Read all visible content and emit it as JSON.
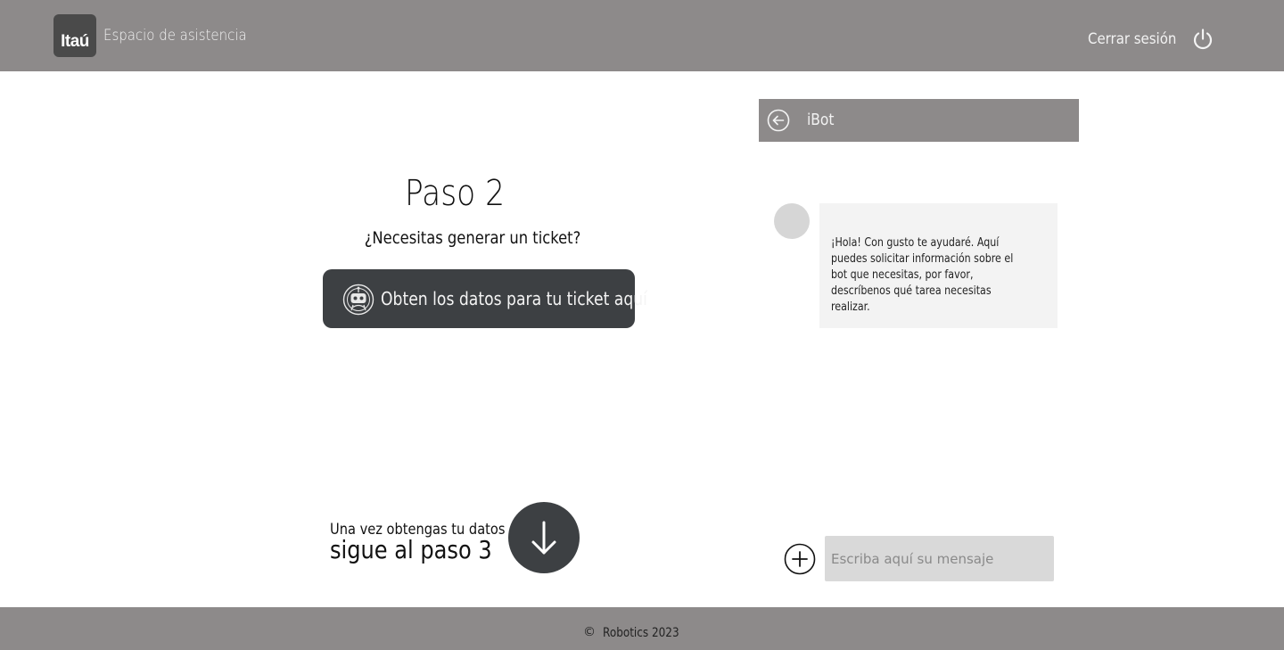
{
  "header": {
    "logo_text": "Itaú",
    "title": "Espacio de asistencia",
    "logout_label": "Cerrar sesión",
    "power_icon": "power-icon"
  },
  "main": {
    "step_title": "Paso 2",
    "question": "¿Necesitas generar un ticket?",
    "ticket_button_label": "Obten los datos para tu ticket aquí",
    "ticket_button_icon": "robot-icon",
    "hint_small": "Una vez obtengas tu datos",
    "hint_big": "sigue al paso 3",
    "down_icon": "arrow-down-icon"
  },
  "chat": {
    "title": "iBot",
    "back_icon": "arrow-left-circle-icon",
    "messages": [
      {
        "from": "bot",
        "text": "¡Hola! Con gusto te ayudaré. Aquí puedes solicitar información sobre el bot que necesitas, por favor, descríbenos qué tarea necesitas realizar."
      }
    ],
    "input_placeholder": "Escriba aquí su mensaje",
    "input_value": "",
    "add_icon": "plus-circle-icon"
  },
  "footer": {
    "copyright_symbol": "©",
    "text": "Robotics 2023"
  },
  "colors": {
    "bar_gray": "#8d8a8a",
    "dark_button": "#3d4043",
    "bubble": "#f3f3f3",
    "input_bg": "#d9d9d9"
  }
}
